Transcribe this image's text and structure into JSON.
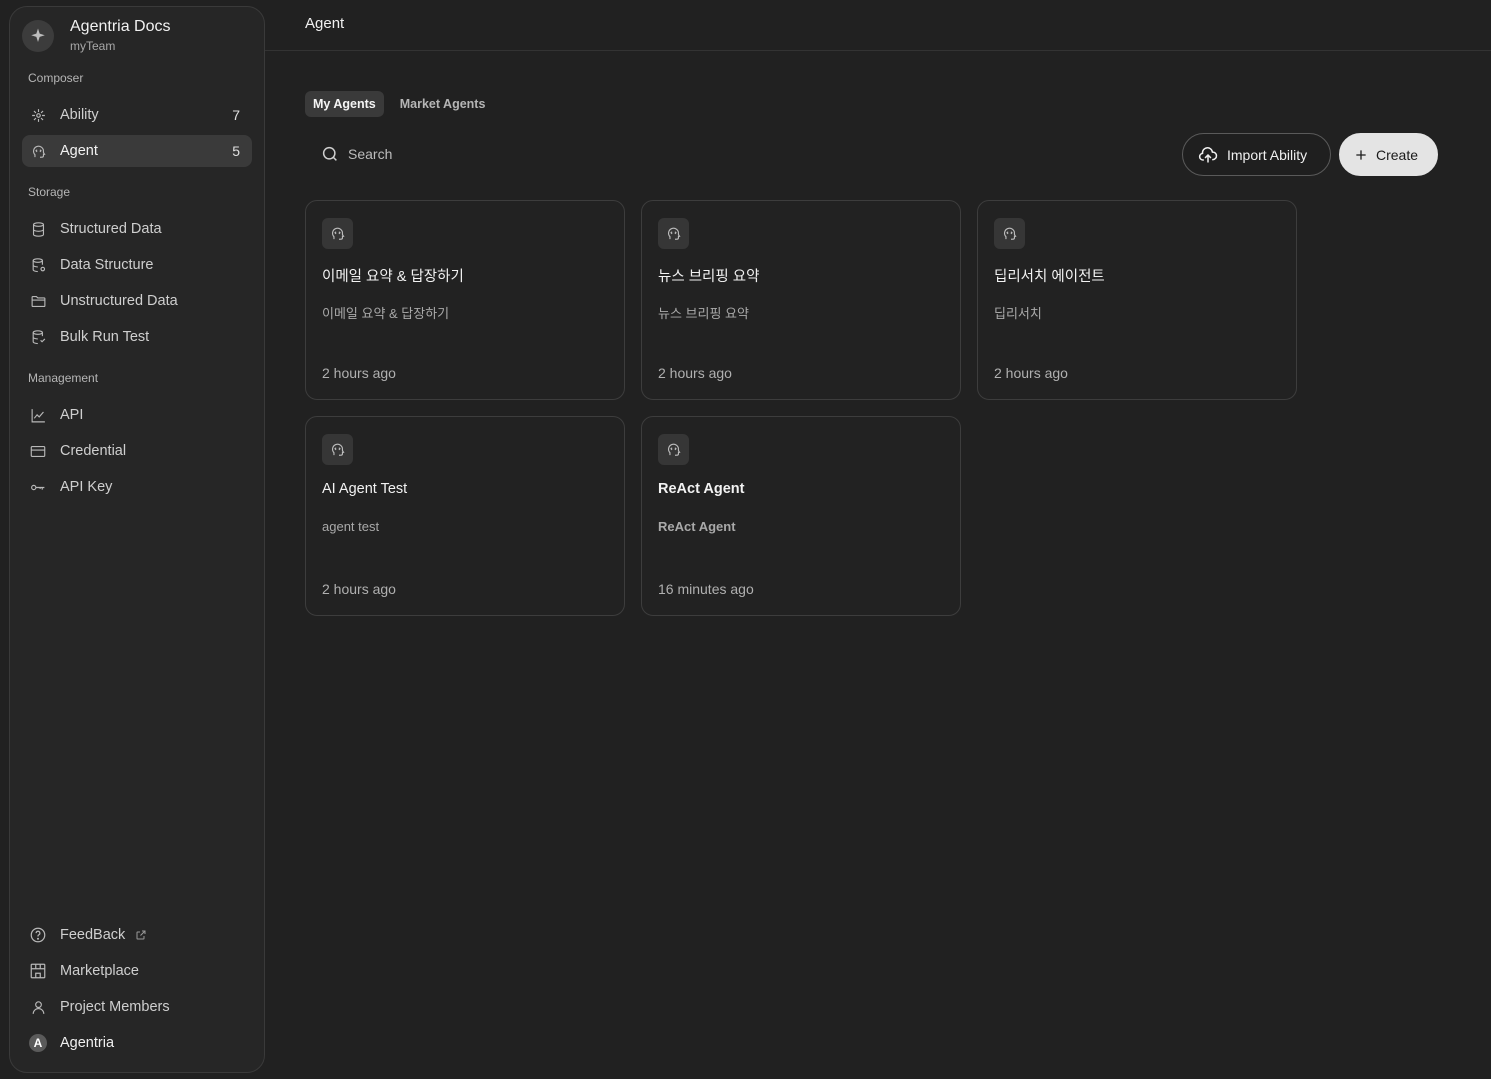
{
  "brand": {
    "title": "Agentria Docs",
    "subtitle": "myTeam"
  },
  "sidebar": {
    "sections": {
      "composer": "Composer",
      "storage": "Storage",
      "management": "Management"
    },
    "composer_items": [
      {
        "label": "Ability",
        "count": "7",
        "icon": "ability-icon"
      },
      {
        "label": "Agent",
        "count": "5",
        "icon": "agent-icon",
        "active": true
      }
    ],
    "storage_items": [
      {
        "label": "Structured Data",
        "icon": "database-icon"
      },
      {
        "label": "Data Structure",
        "icon": "database-schema-icon"
      },
      {
        "label": "Unstructured Data",
        "icon": "folder-icon"
      },
      {
        "label": "Bulk Run Test",
        "icon": "database-test-icon"
      }
    ],
    "management_items": [
      {
        "label": "API",
        "icon": "chart-line-icon"
      },
      {
        "label": "Credential",
        "icon": "credit-card-icon"
      },
      {
        "label": "API Key",
        "icon": "key-icon"
      }
    ],
    "bottom_items": [
      {
        "label": "FeedBack",
        "icon": "help-circle-icon"
      },
      {
        "label": "Marketplace",
        "icon": "store-icon"
      },
      {
        "label": "Project Members",
        "icon": "user-icon"
      },
      {
        "label": "Agentria",
        "icon": "avatar",
        "avatar_letter": "A"
      }
    ]
  },
  "header": {
    "title": "Agent"
  },
  "tabs": [
    {
      "label": "My Agents",
      "active": true
    },
    {
      "label": "Market Agents",
      "active": false
    }
  ],
  "search": {
    "placeholder": "Search",
    "value": ""
  },
  "actions": {
    "import_label": "Import Ability",
    "create_label": "Create"
  },
  "agents": [
    {
      "title": "이메일 요약 & 답장하기",
      "description": "이메일 요약 & 답장하기",
      "time": "2 hours ago"
    },
    {
      "title": "뉴스 브리핑 요약",
      "description": "뉴스 브리핑 요약",
      "time": "2 hours ago"
    },
    {
      "title": "딥리서치 에이전트",
      "description": "딥리서치",
      "time": "2 hours ago"
    },
    {
      "title": "AI Agent Test",
      "description": "agent test",
      "time": "2 hours ago"
    },
    {
      "title": "ReAct Agent",
      "description": "ReAct Agent",
      "time": "16 minutes ago"
    }
  ],
  "colors": {
    "background": "#212121",
    "sidebar": "#262626",
    "active_item": "#3a3a3a",
    "create_button": "#e4e4e4"
  }
}
